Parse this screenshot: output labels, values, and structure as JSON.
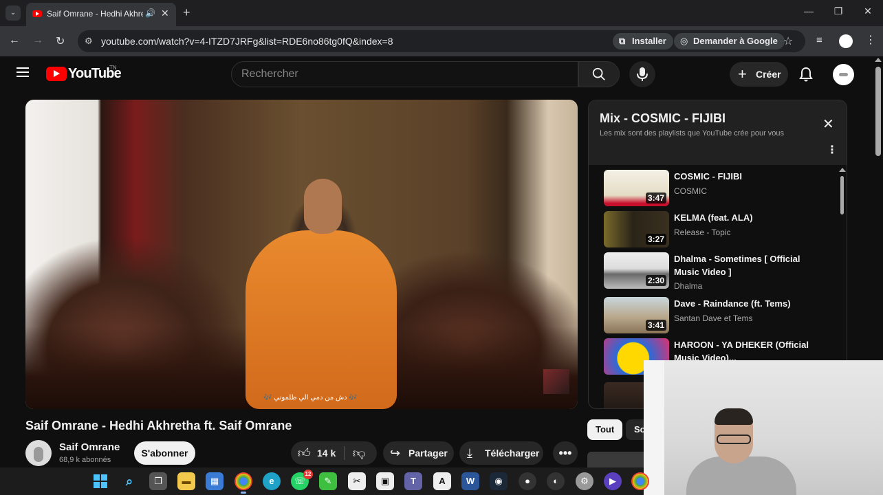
{
  "browser": {
    "tab": {
      "title": "Saif Omrane - Hedhi Akhretha ft. Saif Omrane - YouTube"
    },
    "address": "youtube.com/watch?v=4-ITZD7JRFg&list=RDE6no86tg0fQ&index=8",
    "install_label": "Installer",
    "ask_google_label": "Demander à Google"
  },
  "youtube": {
    "logo_text": "YouTube",
    "logo_suffix": "TN",
    "search_placeholder": "Rechercher",
    "create_label": "Créer"
  },
  "video": {
    "title": "Saif Omrane - Hedhi Akhretha ft. Saif Omrane",
    "caption": "🎶 دش من دمي الي ظلموني 🎶",
    "channel_name": "Saif Omrane",
    "subscribers": "68,9 k abonnés",
    "subscribe_label": "S'abonner",
    "likes": "14 k",
    "share_label": "Partager",
    "download_label": "Télécharger"
  },
  "playlist": {
    "title": "Mix - COSMIC - FIJIBI",
    "subtitle": "Les mix sont des playlists que YouTube crée pour vous",
    "items": [
      {
        "title": "COSMIC - FIJIBI",
        "artist": "COSMIC",
        "duration": "3:47"
      },
      {
        "title": "KELMA (feat. ALA)",
        "artist": "Release - Topic",
        "duration": "3:27"
      },
      {
        "title": "Dhalma - Sometimes [ Official Music Video ]",
        "artist": "Dhalma",
        "duration": "2:30"
      },
      {
        "title": "Dave - Raindance (ft. Tems)",
        "artist": "Santan Dave et Tems",
        "duration": "3:41"
      },
      {
        "title": "HAROON - YA DHEKER (Official Music Video)...",
        "artist": "",
        "duration": ""
      }
    ]
  },
  "chips": [
    "Tout",
    "So"
  ],
  "taskbar": {
    "whatsapp_badge": "12"
  },
  "colors": {
    "yt_red": "#ff0000",
    "background": "#0f0f0f",
    "video_orange": "#e07a24"
  }
}
